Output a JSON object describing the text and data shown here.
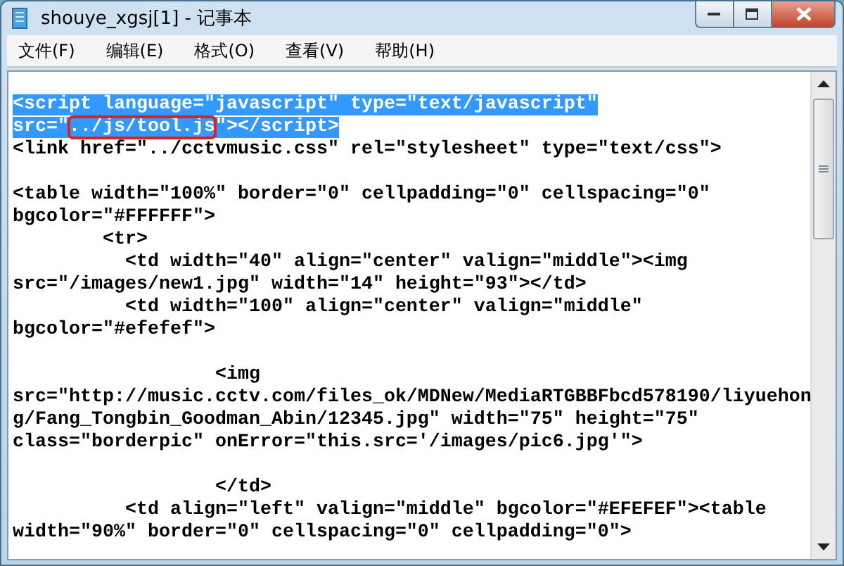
{
  "window": {
    "title": "shouye_xgsj[1] - 记事本"
  },
  "menu": [
    {
      "label": "文件(F)"
    },
    {
      "label": "编辑(E)"
    },
    {
      "label": "格式(O)"
    },
    {
      "label": "查看(V)"
    },
    {
      "label": "帮助(H)"
    }
  ],
  "lines": [
    {
      "kind": "text",
      "selected": true,
      "segments": [
        {
          "text": "<script language=\"javascript\" type=\"text/javascript\"",
          "boxed": false
        }
      ]
    },
    {
      "kind": "text",
      "selected": true,
      "segments": [
        {
          "text": "src=\"",
          "boxed": false
        },
        {
          "text": "../js/tool.js",
          "boxed": true
        },
        {
          "text": "\"></script>",
          "boxed": false
        }
      ]
    },
    {
      "kind": "text",
      "selected": false,
      "segments": [
        {
          "text": "<link href=\"../cctvmusic.css\" rel=\"stylesheet\" type=\"text/css\">",
          "boxed": false
        }
      ]
    },
    {
      "kind": "blank"
    },
    {
      "kind": "text",
      "selected": false,
      "segments": [
        {
          "text": "<table width=\"100%\" border=\"0\" cellpadding=\"0\" cellspacing=\"0\"",
          "boxed": false
        }
      ]
    },
    {
      "kind": "text",
      "selected": false,
      "segments": [
        {
          "text": "bgcolor=\"#FFFFFF\">",
          "boxed": false
        }
      ]
    },
    {
      "kind": "text",
      "selected": false,
      "segments": [
        {
          "text": "        <tr>",
          "boxed": false
        }
      ]
    },
    {
      "kind": "text",
      "selected": false,
      "segments": [
        {
          "text": "          <td width=\"40\" align=\"center\" valign=\"middle\"><img",
          "boxed": false
        }
      ]
    },
    {
      "kind": "text",
      "selected": false,
      "segments": [
        {
          "text": "src=\"/images/new1.jpg\" width=\"14\" height=\"93\"></td>",
          "boxed": false
        }
      ]
    },
    {
      "kind": "text",
      "selected": false,
      "segments": [
        {
          "text": "          <td width=\"100\" align=\"center\" valign=\"middle\"",
          "boxed": false
        }
      ]
    },
    {
      "kind": "text",
      "selected": false,
      "segments": [
        {
          "text": "bgcolor=\"#efefef\">",
          "boxed": false
        }
      ]
    },
    {
      "kind": "blank"
    },
    {
      "kind": "text",
      "selected": false,
      "segments": [
        {
          "text": "                  <img",
          "boxed": false
        }
      ]
    },
    {
      "kind": "text",
      "selected": false,
      "segments": [
        {
          "text": "src=\"http://music.cctv.com/files_ok/MDNew/MediaRTGBBFbcd578190/liyuehon",
          "boxed": false
        }
      ]
    },
    {
      "kind": "text",
      "selected": false,
      "segments": [
        {
          "text": "g/Fang_Tongbin_Goodman_Abin/12345.jpg\" width=\"75\" height=\"75\"",
          "boxed": false
        }
      ]
    },
    {
      "kind": "text",
      "selected": false,
      "segments": [
        {
          "text": "class=\"borderpic\" onError=\"this.src='/images/pic6.jpg'\">",
          "boxed": false
        }
      ]
    },
    {
      "kind": "blank"
    },
    {
      "kind": "text",
      "selected": false,
      "segments": [
        {
          "text": "                  </td>",
          "boxed": false
        }
      ]
    },
    {
      "kind": "text",
      "selected": false,
      "segments": [
        {
          "text": "          <td align=\"left\" valign=\"middle\" bgcolor=\"#EFEFEF\"><table",
          "boxed": false
        }
      ]
    },
    {
      "kind": "text",
      "selected": false,
      "segments": [
        {
          "text": "width=\"90%\" border=\"0\" cellspacing=\"0\" cellpadding=\"0\">",
          "boxed": false
        }
      ]
    }
  ]
}
